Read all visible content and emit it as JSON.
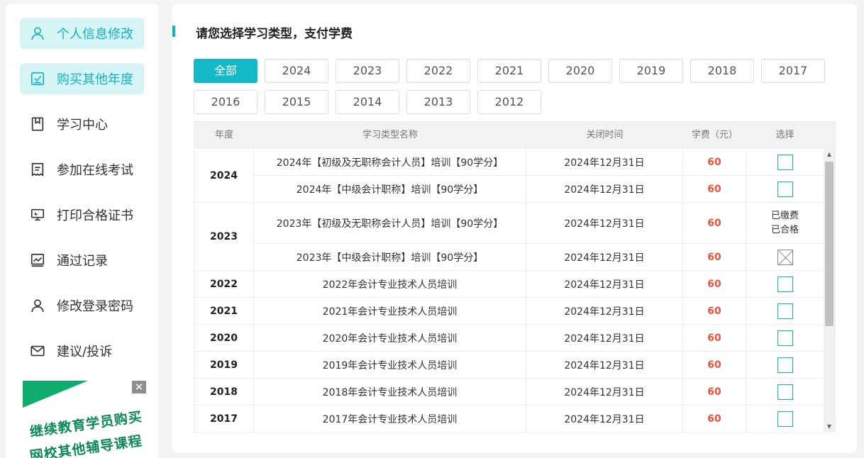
{
  "sidebar": {
    "items": [
      {
        "label": "个人信息修改",
        "icon": "user-icon",
        "active": true
      },
      {
        "label": "购买其他年度",
        "icon": "checkbox-icon",
        "active": true
      },
      {
        "label": "学习中心",
        "icon": "bookmark-icon",
        "active": false
      },
      {
        "label": "参加在线考试",
        "icon": "document-icon",
        "active": false
      },
      {
        "label": "打印合格证书",
        "icon": "monitor-icon",
        "active": false
      },
      {
        "label": "通过记录",
        "icon": "chart-icon",
        "active": false
      },
      {
        "label": "修改登录密码",
        "icon": "user-icon",
        "active": false
      },
      {
        "label": "建议/投诉",
        "icon": "mail-icon",
        "active": false
      }
    ],
    "promo": {
      "close": "✕",
      "line1": "继续教育学员购买",
      "line2": "网校其他辅导课程"
    }
  },
  "main": {
    "title": "请您选择学习类型，支付学费",
    "years": [
      "全部",
      "2024",
      "2023",
      "2022",
      "2021",
      "2020",
      "2019",
      "2018",
      "2017",
      "2016",
      "2015",
      "2014",
      "2013",
      "2012"
    ],
    "active_year": "全部",
    "table": {
      "headers": [
        "年度",
        "学习类型名称",
        "关闭时间",
        "学费（元）",
        "选择"
      ],
      "groups": [
        {
          "year": "2024",
          "rows": [
            {
              "name": "2024年【初级及无职称会计人员】培训【90学分】",
              "close": "2024年12月31日",
              "fee": "60",
              "select": "checkbox"
            },
            {
              "name": "2024年【中级会计职称】培训【90学分】",
              "close": "2024年12月31日",
              "fee": "60",
              "select": "checkbox"
            }
          ]
        },
        {
          "year": "2023",
          "rows": [
            {
              "name": "2023年【初级及无职称会计人员】培训【90学分】",
              "close": "2024年12月31日",
              "fee": "60",
              "select": "status",
              "status1": "已缴费",
              "status2": "已合格"
            },
            {
              "name": "2023年【中级会计职称】培训【90学分】",
              "close": "2024年12月31日",
              "fee": "60",
              "select": "disabled"
            }
          ]
        },
        {
          "year": "2022",
          "rows": [
            {
              "name": "2022年会计专业技术人员培训",
              "close": "2024年12月31日",
              "fee": "60",
              "select": "checkbox"
            }
          ]
        },
        {
          "year": "2021",
          "rows": [
            {
              "name": "2021年会计专业技术人员培训",
              "close": "2024年12月31日",
              "fee": "60",
              "select": "checkbox"
            }
          ]
        },
        {
          "year": "2020",
          "rows": [
            {
              "name": "2020年会计专业技术人员培训",
              "close": "2024年12月31日",
              "fee": "60",
              "select": "checkbox"
            }
          ]
        },
        {
          "year": "2019",
          "rows": [
            {
              "name": "2019年会计专业技术人员培训",
              "close": "2024年12月31日",
              "fee": "60",
              "select": "checkbox"
            }
          ]
        },
        {
          "year": "2018",
          "rows": [
            {
              "name": "2018年会计专业技术人员培训",
              "close": "2024年12月31日",
              "fee": "60",
              "select": "checkbox"
            }
          ]
        },
        {
          "year": "2017",
          "rows": [
            {
              "name": "2017年会计专业技术人员培训",
              "close": "2024年12月31日",
              "fee": "60",
              "select": "checkbox"
            }
          ]
        }
      ]
    },
    "scroll": {
      "up": "▲",
      "down": "▼"
    }
  },
  "colors": {
    "accent": "#13b4c1",
    "fee": "#f0513a",
    "active_bg": "#d6f3f6"
  }
}
